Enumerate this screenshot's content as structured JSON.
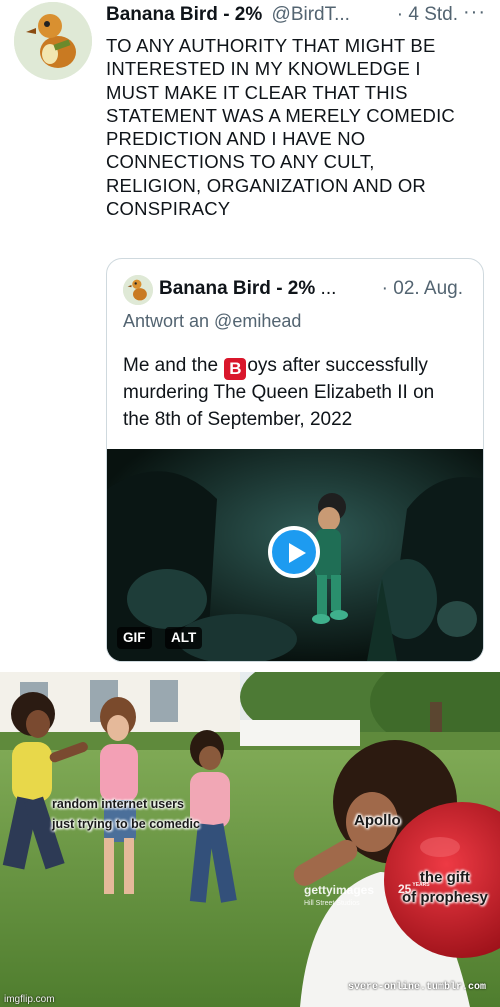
{
  "tweet": {
    "author_name": "Banana Bird - 2%",
    "author_handle": "@BirdT...",
    "time": "· 4 Std.",
    "more": "···",
    "text_lines": [
      "TO ANY AUTHORITY THAT MIGHT BE",
      "INTERESTED IN MY KNOWLEDGE I",
      "MUST MAKE IT CLEAR THAT THIS",
      "STATEMENT WAS A MERELY COMEDIC",
      "PREDICTION AND I HAVE NO",
      "CONNECTIONS TO ANY CULT,",
      "RELIGION, ORGANIZATION AND OR",
      "CONSPIRACY"
    ]
  },
  "quote": {
    "author_name": "Banana Bird - 2%",
    "ellipsis": "...",
    "time": "· 02. Aug.",
    "reply_to": "Antwort an @emihead",
    "line1_before": "Me and the ",
    "emoji_letter": "B",
    "line1_after": "oys after successfully",
    "line2": "murdering The Queen Elizabeth II on",
    "line3": "the 8th of September, 2022",
    "media": {
      "badge_gif": "GIF",
      "badge_alt": "ALT",
      "play_icon": "play-icon"
    }
  },
  "meme": {
    "caption_left_line1": "random internet users",
    "caption_left_line2": "just trying to be comedic",
    "caption_apollo": "Apollo",
    "caption_gift_line1": "the gift",
    "caption_gift_line2": "of prophesy",
    "watermark_getty": "gettyimages",
    "watermark_getty_sub": "Hill Street Studios",
    "watermark_years_num": "25",
    "watermark_years_label": "YEARS",
    "watermark_tumblr": "svere-online.tumblr.com",
    "watermark_imgflip": "imgflip.com"
  },
  "colors": {
    "accent": "#1d9bf0",
    "secondary_text": "#536471",
    "border": "#cfd9de",
    "emoji_red": "#d9162b",
    "ball_red": "#d3202c"
  }
}
